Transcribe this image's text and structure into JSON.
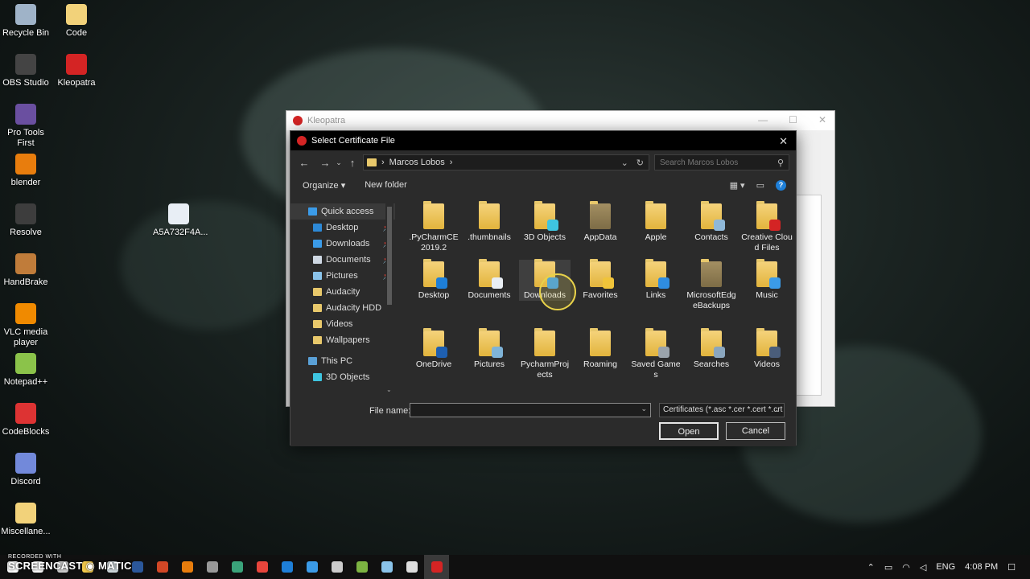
{
  "desktop": {
    "icons": [
      {
        "label": "Recycle Bin",
        "color": "#9fb3c8"
      },
      {
        "label": "Code",
        "color": "#f2d27a"
      },
      {
        "label": "OBS Studio",
        "color": "#444"
      },
      {
        "label": "Kleopatra",
        "color": "#d42424"
      },
      {
        "label": "Pro Tools First",
        "color": "#6a4fa0"
      },
      {
        "label": "blender",
        "color": "#e87d0d"
      },
      {
        "label": "A5A732F4A...",
        "color": "#e8eef5"
      },
      {
        "label": "Resolve",
        "color": "#3d3d3d"
      },
      {
        "label": "HandBrake",
        "color": "#c07c3a"
      },
      {
        "label": "VLC media player",
        "color": "#f08a00"
      },
      {
        "label": "Notepad++",
        "color": "#8bc34a"
      },
      {
        "label": "CodeBlocks",
        "color": "#d33"
      },
      {
        "label": "Discord",
        "color": "#7289da"
      },
      {
        "label": "Miscellane...",
        "color": "#f2d27a"
      }
    ]
  },
  "kleopatra": {
    "title": "Kleopatra",
    "controls": [
      "—",
      "☐",
      "✕"
    ]
  },
  "dialog": {
    "title": "Select Certificate File",
    "close": "✕",
    "nav": {
      "back": "←",
      "forward": "→",
      "recent": "⌄",
      "up": "↑"
    },
    "address": {
      "sep1": "›",
      "path": "Marcos Lobos",
      "sep2": "›",
      "dropdown": "⌄",
      "refresh": "↻"
    },
    "search": {
      "placeholder": "Search Marcos Lobos",
      "icon": "⚲"
    },
    "toolbar": {
      "organize": "Organize ▾",
      "new_folder": "New folder",
      "view": "▦ ▾",
      "pane": "▭",
      "help": "?"
    },
    "nav_pane": [
      {
        "label": "Quick access",
        "color": "#3b9be8",
        "indent": 22,
        "pin": false
      },
      {
        "label": "Desktop",
        "color": "#2d89d6",
        "indent": 28,
        "pin": true
      },
      {
        "label": "Downloads",
        "color": "#3b9be8",
        "indent": 28,
        "pin": true
      },
      {
        "label": "Documents",
        "color": "#cfd8e3",
        "indent": 28,
        "pin": true
      },
      {
        "label": "Pictures",
        "color": "#8ac3ea",
        "indent": 28,
        "pin": true
      },
      {
        "label": "Audacity",
        "color": "#e8c86b",
        "indent": 28,
        "pin": false
      },
      {
        "label": "Audacity HDD",
        "color": "#e8c86b",
        "indent": 28,
        "pin": false
      },
      {
        "label": "Videos",
        "color": "#e8c86b",
        "indent": 28,
        "pin": false
      },
      {
        "label": "Wallpapers",
        "color": "#e8c86b",
        "indent": 28,
        "pin": false
      },
      {
        "label": "This PC",
        "color": "#5aa0d6",
        "indent": 22,
        "pin": false
      },
      {
        "label": "3D Objects",
        "color": "#3ec5e0",
        "indent": 28,
        "pin": false
      }
    ],
    "pin_glyph": "📌",
    "scroll_arrow": "⌄",
    "items": [
      {
        "label": ".PyCharmCE 2019.2",
        "dark": false,
        "overlay": ""
      },
      {
        "label": ".thumbnails",
        "dark": false,
        "overlay": ""
      },
      {
        "label": "3D Objects",
        "dark": false,
        "overlay": "#3ec5e0"
      },
      {
        "label": "AppData",
        "dark": true,
        "overlay": ""
      },
      {
        "label": "Apple",
        "dark": false,
        "overlay": ""
      },
      {
        "label": "Contacts",
        "dark": false,
        "overlay": "#8fb8d8"
      },
      {
        "label": "Creative Cloud Files",
        "dark": false,
        "overlay": "#d42424"
      },
      {
        "label": "Desktop",
        "dark": false,
        "overlay": "#1e7fd8"
      },
      {
        "label": "Documents",
        "dark": false,
        "overlay": "#e9eef4"
      },
      {
        "label": "Downloads",
        "dark": false,
        "overlay": "#3b9be8"
      },
      {
        "label": "Favorites",
        "dark": false,
        "overlay": "#f0c43a"
      },
      {
        "label": "Links",
        "dark": false,
        "overlay": "#2f8de0"
      },
      {
        "label": "MicrosoftEdgeBackups",
        "dark": true,
        "overlay": ""
      },
      {
        "label": "Music",
        "dark": false,
        "overlay": "#3b9be8"
      },
      {
        "label": "OneDrive",
        "dark": false,
        "overlay": "#1e5fb0"
      },
      {
        "label": "Pictures",
        "dark": false,
        "overlay": "#7fb4d8"
      },
      {
        "label": "PycharmProjects",
        "dark": false,
        "overlay": ""
      },
      {
        "label": "Roaming",
        "dark": false,
        "overlay": ""
      },
      {
        "label": "Saved Games",
        "dark": false,
        "overlay": "#9aa3ab"
      },
      {
        "label": "Searches",
        "dark": false,
        "overlay": "#8aa6be"
      },
      {
        "label": "Videos",
        "dark": false,
        "overlay": "#4a5d7a"
      }
    ],
    "hovered_item": "Downloads",
    "file_name": {
      "label": "File name:",
      "value": "",
      "dropdown": "⌄"
    },
    "filter": {
      "value": "Certificates (*.asc *.cer *.cert *.crt",
      "dropdown": "⌄"
    },
    "open": "Open",
    "cancel": "Cancel"
  },
  "taskbar": {
    "apps": [
      {
        "name": "windows",
        "color": "#ffffff"
      },
      {
        "name": "screencast",
        "color": "#ffffff"
      },
      {
        "name": "obs",
        "color": "#cccccc"
      },
      {
        "name": "explorer",
        "color": "#f2c94c"
      },
      {
        "name": "notes",
        "color": "#cfd8dc"
      },
      {
        "name": "word",
        "color": "#2b579a"
      },
      {
        "name": "powerpoint",
        "color": "#d24726"
      },
      {
        "name": "blender",
        "color": "#e87d0d"
      },
      {
        "name": "resolve",
        "color": "#999999"
      },
      {
        "name": "terminal",
        "color": "#3aa37a"
      },
      {
        "name": "chrome",
        "color": "#e8453c"
      },
      {
        "name": "edge",
        "color": "#1e7fd8"
      },
      {
        "name": "vscode",
        "color": "#3b9be8"
      },
      {
        "name": "vmware",
        "color": "#cccccc"
      },
      {
        "name": "store",
        "color": "#7cb342"
      },
      {
        "name": "notepad",
        "color": "#8ac3ea"
      },
      {
        "name": "obs2",
        "color": "#dddddd"
      },
      {
        "name": "kleopatra",
        "color": "#d42424"
      }
    ],
    "tray": {
      "up": "⌃",
      "lang": "ENG",
      "time": "4:08 PM",
      "notifications": "☐"
    },
    "watermark": {
      "line1": "RECORDED WITH",
      "line2": "SCREENCAST ◉ MATIC"
    }
  }
}
